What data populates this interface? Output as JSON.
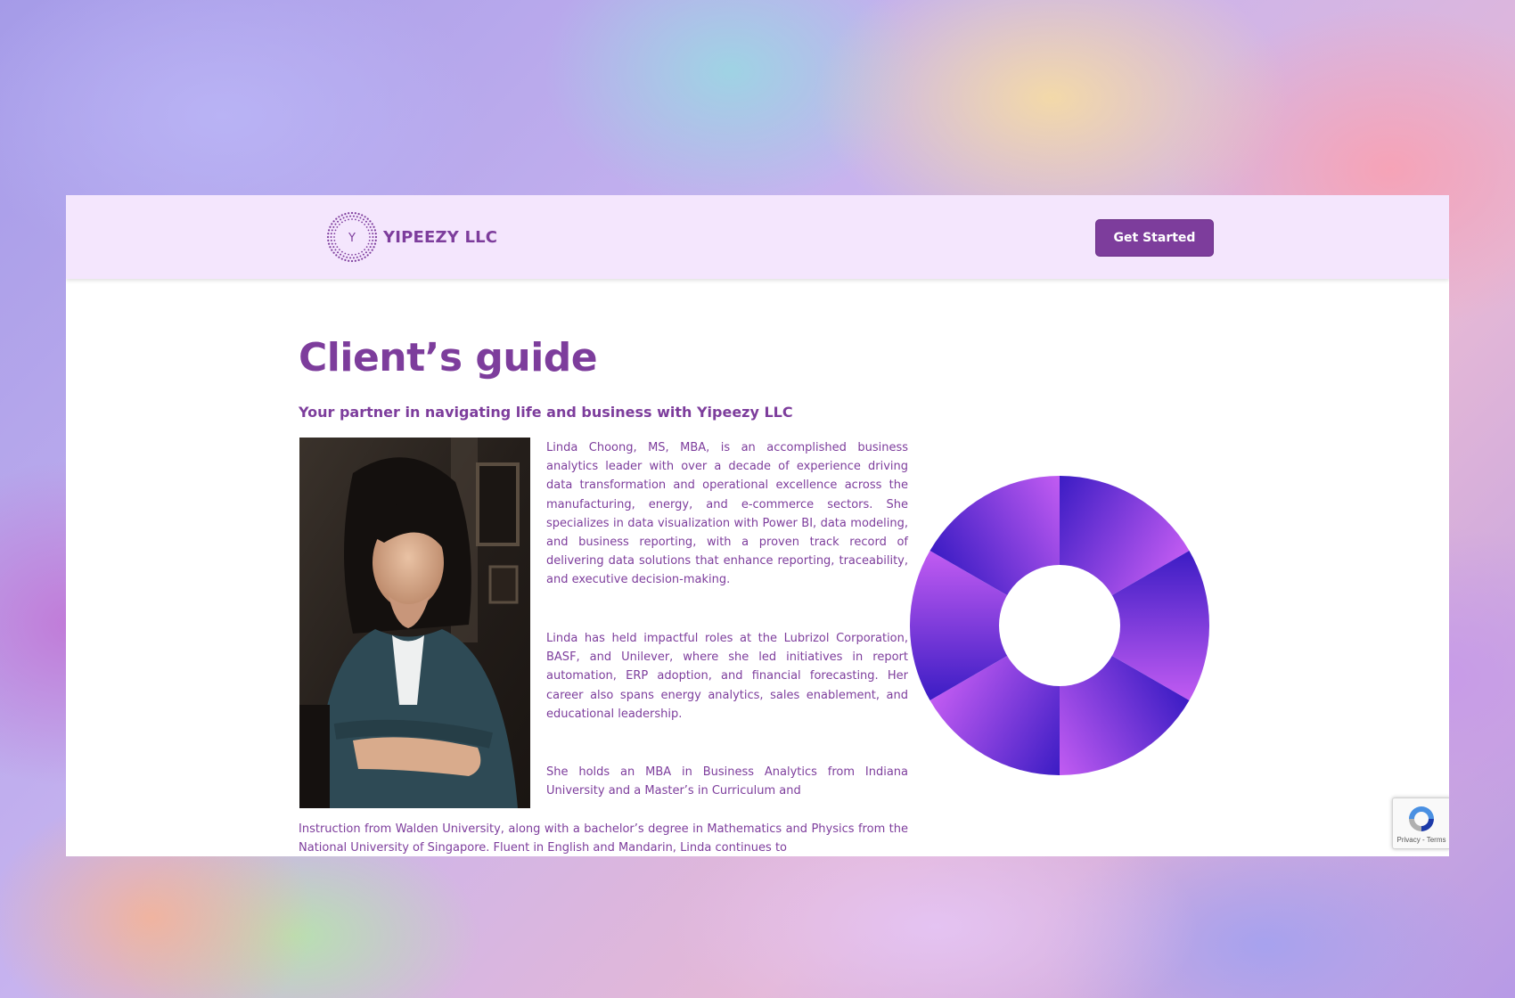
{
  "header": {
    "logo_letter": "Y",
    "brand": "YIPEEZY LLC",
    "cta_label": "Get Started"
  },
  "main": {
    "title": "Client’s guide",
    "subtitle": "Your partner in navigating life and business with Yipeezy LLC",
    "paragraphs": [
      "Linda Choong, MS, MBA, is an accomplished business analytics leader with over a decade of experience driving data transformation and operational excellence across the manufacturing, energy, and e-commerce sectors. She specializes in data visualization with Power BI, data modeling, and business reporting, with a proven track record of delivering data solutions that enhance reporting, traceability, and executive decision-making.",
      "Linda has held impactful roles at the Lubrizol Corporation, BASF, and Unilever, where she led initiatives in report automation, ERP adoption, and financial forecasting. Her career also spans energy analytics, sales enablement, and educational leadership.",
      "She holds an MBA in Business Analytics from Indiana University and a Master’s in Curriculum and",
      "Instruction from Walden University, along with a bachelor’s degree in Mathematics and Physics from the National University of Singapore. Fluent in English and Mandarin, Linda continues to"
    ]
  },
  "recaptcha": {
    "privacy_label": "Privacy",
    "separator": " - ",
    "terms_label": "Terms"
  },
  "colors": {
    "brand_purple": "#7d3d9c",
    "header_bg": "#f4e6fd",
    "donut_light": "#c25cf2",
    "donut_dark": "#3b1cc4"
  },
  "icons": {
    "logo": "dotted-circle-logo-icon",
    "recaptcha": "recaptcha-icon"
  }
}
